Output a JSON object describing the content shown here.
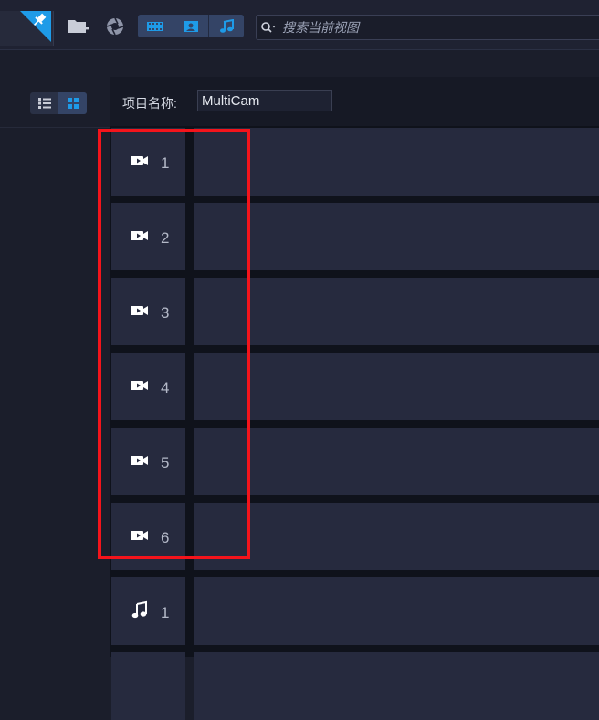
{
  "toolbar": {
    "search_placeholder": "搜索当前视图"
  },
  "project": {
    "label": "项目名称:",
    "name": "MultiCam"
  },
  "tracks": [
    {
      "type": "video",
      "number": "1"
    },
    {
      "type": "video",
      "number": "2"
    },
    {
      "type": "video",
      "number": "3"
    },
    {
      "type": "video",
      "number": "4"
    },
    {
      "type": "video",
      "number": "5"
    },
    {
      "type": "video",
      "number": "6"
    },
    {
      "type": "audio",
      "number": "1"
    }
  ],
  "colors": {
    "accent": "#1e9be8",
    "highlight": "#f4141b",
    "panel": "#262a3e",
    "background": "#1b1e2b"
  }
}
